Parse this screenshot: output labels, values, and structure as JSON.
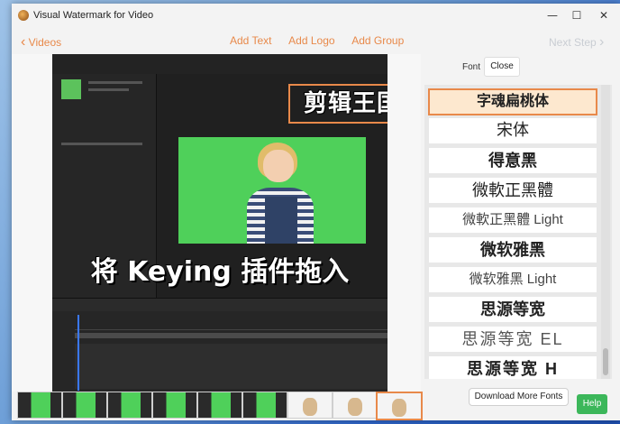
{
  "window": {
    "title": "Visual Watermark for Video"
  },
  "titlebar": {
    "minimize_glyph": "—",
    "maximize_glyph": "☐",
    "close_glyph": "✕"
  },
  "nav": {
    "back_label": "Videos",
    "back_glyph": "‹",
    "add_text": "Add Text",
    "add_logo": "Add Logo",
    "add_group": "Add Group",
    "next_label": "Next Step",
    "next_glyph": "›"
  },
  "preview": {
    "watermark_title": "剪辑王国",
    "watermark_subtitle": "将 Keying 插件拖入"
  },
  "font_panel": {
    "label": "Font",
    "close_button": "Close",
    "download_button": "Download More Fonts",
    "items": [
      {
        "name": "字魂扁桃体",
        "selected": true
      },
      {
        "name": "宋体"
      },
      {
        "name": "得意黑"
      },
      {
        "name": "微軟正黑體"
      },
      {
        "name": "微軟正黑體 Light"
      },
      {
        "name": "微软雅黑"
      },
      {
        "name": "微软雅黑 Light"
      },
      {
        "name": "思源等宽"
      },
      {
        "name": "思源等宽  EL"
      },
      {
        "name": "思源等宽  H"
      }
    ]
  },
  "help_button": "Help",
  "colors": {
    "accent": "#e8894a",
    "help_green": "#3cb75a",
    "chroma_green": "#4fd05a"
  }
}
